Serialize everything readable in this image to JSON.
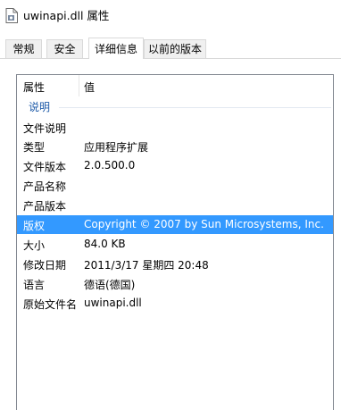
{
  "window": {
    "title": "uwinapi.dll 属性"
  },
  "tabs": [
    {
      "label": "常规",
      "active": false
    },
    {
      "label": "安全",
      "active": false
    },
    {
      "label": "详细信息",
      "active": true
    },
    {
      "label": "以前的版本",
      "active": false
    }
  ],
  "table": {
    "col_property": "属性",
    "col_value": "值",
    "group_label": "说明",
    "rows": [
      {
        "name": "文件说明",
        "value": ""
      },
      {
        "name": "类型",
        "value": "应用程序扩展"
      },
      {
        "name": "文件版本",
        "value": "2.0.500.0"
      },
      {
        "name": "产品名称",
        "value": ""
      },
      {
        "name": "产品版本",
        "value": ""
      },
      {
        "name": "版权",
        "value": "Copyright © 2007 by Sun Microsystems, Inc.",
        "selected": true
      },
      {
        "name": "大小",
        "value": "84.0 KB"
      },
      {
        "name": "修改日期",
        "value": "2011/3/17 星期四 20:48"
      },
      {
        "name": "语言",
        "value": "德语(德国)"
      },
      {
        "name": "原始文件名",
        "value": "uwinapi.dll"
      }
    ]
  },
  "colors": {
    "selection": "#3399ff",
    "group_text": "#1e5aa8",
    "border": "#828790"
  },
  "icons": {
    "file": "dll-file-icon"
  }
}
